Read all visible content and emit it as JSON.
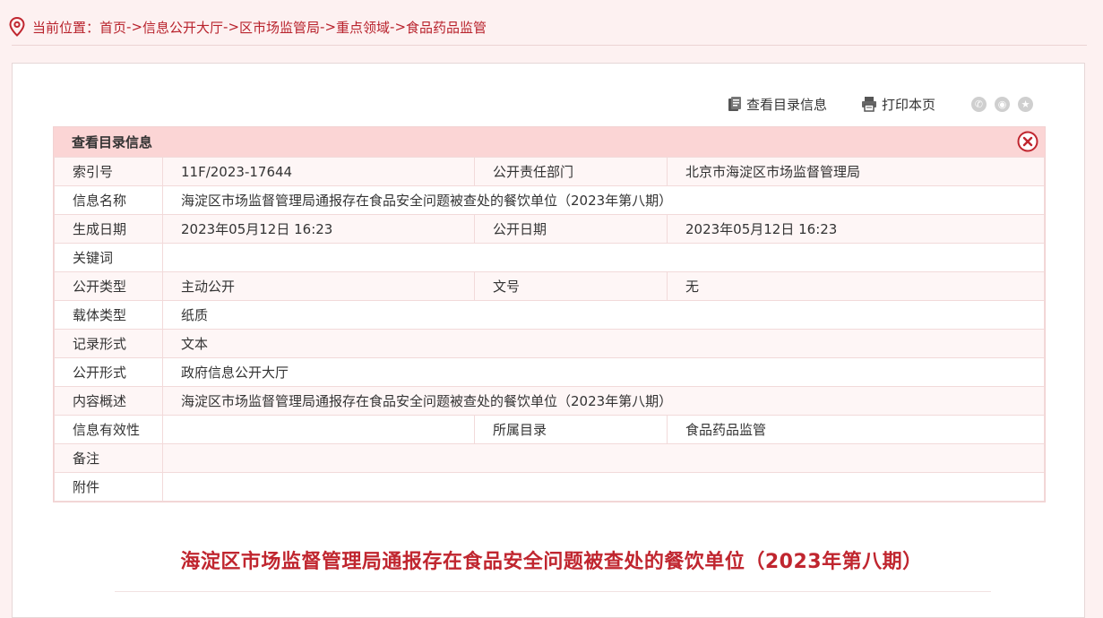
{
  "breadcrumb": {
    "prefix": "当前位置：",
    "items": [
      "首页",
      "信息公开大厅",
      "区市场监管局",
      "重点领域",
      "食品药品监管"
    ],
    "separator": "->"
  },
  "toolbar": {
    "catalog_label": "查看目录信息",
    "print_label": "打印本页",
    "share_icons": [
      "wechat-icon",
      "weibo-icon",
      "favorite-icon"
    ]
  },
  "meta": {
    "header": "查看目录信息",
    "rows": [
      {
        "label": "索引号",
        "value": "11F/2023-17644",
        "label2": "公开责任部门",
        "value2": "北京市海淀区市场监督管理局"
      },
      {
        "label": "信息名称",
        "value": "海淀区市场监督管理局通报存在食品安全问题被查处的餐饮单位（2023年第八期）"
      },
      {
        "label": "生成日期",
        "value": "2023年05月12日 16:23",
        "label2": "公开日期",
        "value2": "2023年05月12日 16:23"
      },
      {
        "label": "关键词",
        "value": ""
      },
      {
        "label": "公开类型",
        "value": "主动公开",
        "label2": "文号",
        "value2": "无"
      },
      {
        "label": "载体类型",
        "value": "纸质"
      },
      {
        "label": "记录形式",
        "value": "文本"
      },
      {
        "label": "公开形式",
        "value": "政府信息公开大厅"
      },
      {
        "label": "内容概述",
        "value": "海淀区市场监督管理局通报存在食品安全问题被查处的餐饮单位（2023年第八期）"
      },
      {
        "label": "信息有效性",
        "value": "",
        "label2": "所属目录",
        "value2": "食品药品监管"
      },
      {
        "label": "备注",
        "value": ""
      },
      {
        "label": "附件",
        "value": ""
      }
    ]
  },
  "article": {
    "title": "海淀区市场监督管理局通报存在食品安全问题被查处的餐饮单位（2023年第八期）"
  },
  "colors": {
    "accent": "#c0262f",
    "header_bg": "#fbd5d5",
    "page_bg": "#fdf1f1"
  }
}
